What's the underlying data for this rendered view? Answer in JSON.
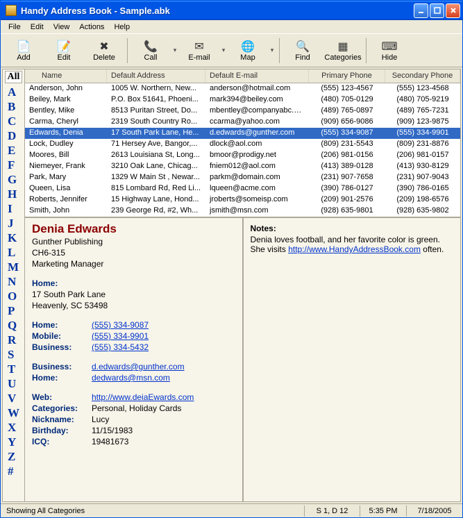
{
  "window": {
    "title": "Handy Address Book - Sample.abk"
  },
  "menu": {
    "file": "File",
    "edit": "Edit",
    "view": "View",
    "actions": "Actions",
    "help": "Help"
  },
  "toolbar": {
    "add": "Add",
    "edit": "Edit",
    "delete": "Delete",
    "call": "Call",
    "email": "E-mail",
    "map": "Map",
    "find": "Find",
    "categories": "Categories",
    "hide": "Hide"
  },
  "alpha": {
    "all": "All",
    "letters": [
      "A",
      "B",
      "C",
      "D",
      "E",
      "F",
      "G",
      "H",
      "I",
      "J",
      "K",
      "L",
      "M",
      "N",
      "O",
      "P",
      "Q",
      "R",
      "S",
      "T",
      "U",
      "V",
      "W",
      "X",
      "Y",
      "Z",
      "#"
    ]
  },
  "grid": {
    "headers": {
      "name": "Name",
      "addr": "Default Address",
      "email": "Default E-mail",
      "p1": "Primary Phone",
      "p2": "Secondary Phone"
    },
    "rows": [
      {
        "name": "Anderson, John",
        "addr": "1005 W. Northern, New...",
        "email": "anderson@hotmail.com",
        "p1": "(555) 123-4567",
        "p2": "(555) 123-4568"
      },
      {
        "name": "Beiley, Mark",
        "addr": "P.O. Box 51641, Phoeni...",
        "email": "mark394@beiley.com",
        "p1": "(480) 705-0129",
        "p2": "(480) 705-9219"
      },
      {
        "name": "Bentley, Mike",
        "addr": "8513 Puritan Street, Do...",
        "email": "mbentley@companyabc.com",
        "p1": "(489) 765-0897",
        "p2": "(489) 765-7231"
      },
      {
        "name": "Carma, Cheryl",
        "addr": "2319 South Country Ro...",
        "email": "ccarma@yahoo.com",
        "p1": "(909) 656-9086",
        "p2": "(909) 123-9875"
      },
      {
        "name": "Edwards, Denia",
        "addr": "17 South Park Lane, He...",
        "email": "d.edwards@gunther.com",
        "p1": "(555) 334-9087",
        "p2": "(555) 334-9901"
      },
      {
        "name": "Lock, Dudley",
        "addr": "71 Hersey Ave, Bangor,...",
        "email": "dlock@aol.com",
        "p1": "(809) 231-5543",
        "p2": "(809) 231-8876"
      },
      {
        "name": "Moores, Bill",
        "addr": "2613 Louisiana St, Long...",
        "email": "bmoor@prodigy.net",
        "p1": "(206) 981-0156",
        "p2": "(206) 981-0157"
      },
      {
        "name": "Niemeyer, Frank",
        "addr": "3210 Oak Lane, Chicag...",
        "email": "fniem012@aol.com",
        "p1": "(413) 389-0128",
        "p2": "(413) 930-8129"
      },
      {
        "name": "Park, Mary",
        "addr": "1329 W Main St , Newar...",
        "email": "parkm@domain.com",
        "p1": "(231) 907-7658",
        "p2": "(231) 907-9043"
      },
      {
        "name": "Queen, Lisa",
        "addr": "815 Lombard Rd, Red Li...",
        "email": "lqueen@acme.com",
        "p1": "(390) 786-0127",
        "p2": "(390) 786-0165"
      },
      {
        "name": "Roberts, Jennifer",
        "addr": "15 Highway Lane, Hond...",
        "email": "jroberts@someisp.com",
        "p1": "(209) 901-2576",
        "p2": "(209) 198-6576"
      },
      {
        "name": "Smith, John",
        "addr": "239 George Rd, #2, Wh...",
        "email": "jsmith@msn.com",
        "p1": "(928) 635-9801",
        "p2": "(928) 635-9802"
      }
    ],
    "selected_index": 4
  },
  "detail": {
    "name": "Denia Edwards",
    "company": "Gunther Publishing",
    "dept": "CH6-315",
    "title": "Marketing Manager",
    "home_addr_label": "Home:",
    "home_addr_1": "17 South Park Lane",
    "home_addr_2": "Heavenly, SC  53498",
    "phones": [
      {
        "label": "Home:",
        "value": "(555) 334-9087"
      },
      {
        "label": "Mobile:",
        "value": "(555) 334-9901"
      },
      {
        "label": "Business:",
        "value": "(555) 334-5432"
      }
    ],
    "emails": [
      {
        "label": "Business:",
        "value": "d.edwards@gunther.com"
      },
      {
        "label": "Home:",
        "value": "dedwards@msn.com"
      }
    ],
    "misc": [
      {
        "label": "Web:",
        "value": "http://www.deiaEwards.com",
        "link": true
      },
      {
        "label": "Categories:",
        "value": "Personal, Holiday Cards"
      },
      {
        "label": "Nickname:",
        "value": "Lucy"
      },
      {
        "label": "Birthday:",
        "value": "11/15/1983"
      },
      {
        "label": "ICQ:",
        "value": "19481673"
      }
    ],
    "notes_label": "Notes:",
    "notes_text1": "Denia loves football, and her favorite color is green.",
    "notes_text2a": "She visits ",
    "notes_link": "http://www.HandyAddressBook.com",
    "notes_text2b": " often."
  },
  "status": {
    "left": "Showing All Categories",
    "sel": "S 1, D 12",
    "time": "5:35 PM",
    "date": "7/18/2005"
  }
}
